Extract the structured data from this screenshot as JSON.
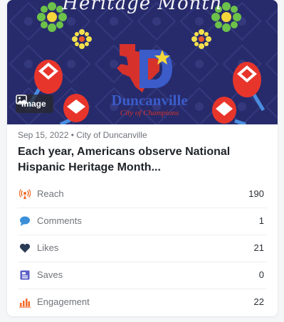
{
  "post": {
    "hero_title": "Heritage Month",
    "brand_name": "Duncanville",
    "brand_tagline": "City of Champions",
    "media_type": "Image",
    "date": "Sep 15, 2022",
    "author": "City of Duncanville",
    "meta": "Sep 15, 2022 • City of Duncanville",
    "headline": "Each year, Americans observe National Hispanic Heritage Month..."
  },
  "metrics": [
    {
      "label": "Reach",
      "value": "190",
      "icon": "broadcast-icon",
      "color": "#f26b2a"
    },
    {
      "label": "Comments",
      "value": "1",
      "icon": "comment-icon",
      "color": "#3b8fd9"
    },
    {
      "label": "Likes",
      "value": "21",
      "icon": "heart-icon",
      "color": "#2b3a55"
    },
    {
      "label": "Saves",
      "value": "0",
      "icon": "bookmark-icon",
      "color": "#5b5fc7"
    },
    {
      "label": "Engagement",
      "value": "22",
      "icon": "bar-chart-icon",
      "color": "#f26b2a"
    }
  ],
  "colors": {
    "hero_background": "#272b6b",
    "brand_blue": "#3b5cc9",
    "brand_red": "#d6322b"
  }
}
